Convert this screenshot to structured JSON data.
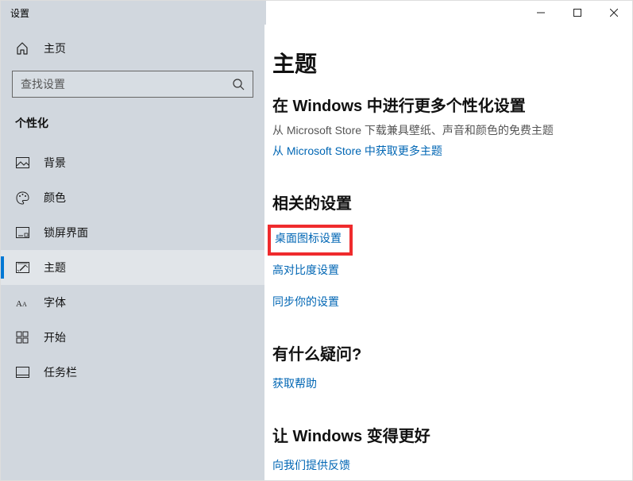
{
  "window": {
    "title": "设置"
  },
  "sidebar": {
    "home": "主页",
    "searchPlaceholder": "查找设置",
    "category": "个性化",
    "items": [
      {
        "label": "背景"
      },
      {
        "label": "颜色"
      },
      {
        "label": "锁屏界面"
      },
      {
        "label": "主题"
      },
      {
        "label": "字体"
      },
      {
        "label": "开始"
      },
      {
        "label": "任务栏"
      }
    ]
  },
  "main": {
    "title": "主题",
    "subtitle": "在 Windows 中进行更多个性化设置",
    "desc": "从 Microsoft Store 下载兼具壁纸、声音和颜色的免费主题",
    "storeLink": "从 Microsoft Store 中获取更多主题",
    "related": {
      "heading": "相关的设置",
      "links": {
        "desktopIcon": "桌面图标设置",
        "highContrast": "高对比度设置",
        "sync": "同步你的设置"
      }
    },
    "questions": {
      "heading": "有什么疑问?",
      "link": "获取帮助"
    },
    "improve": {
      "heading": "让 Windows 变得更好",
      "link": "向我们提供反馈"
    }
  }
}
